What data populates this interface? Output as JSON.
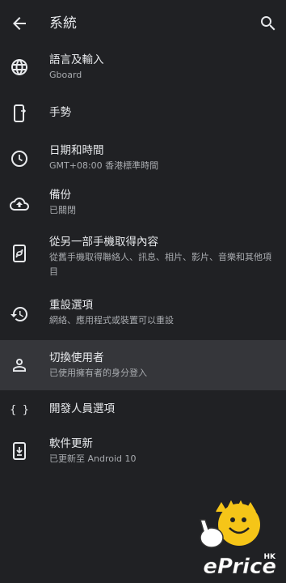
{
  "appbar": {
    "title": "系統",
    "back_icon": "arrow-back-icon",
    "search_icon": "search-icon"
  },
  "items": [
    {
      "label": "語言及輸入",
      "sub": "Gboard",
      "icon": "globe-icon"
    },
    {
      "label": "手勢",
      "sub": "",
      "icon": "phone-gesture-icon"
    },
    {
      "label": "日期和時間",
      "sub": "GMT+08:00 香港標準時間",
      "icon": "clock-icon"
    },
    {
      "label": "備份",
      "sub": "已關閉",
      "icon": "cloud-upload-icon"
    },
    {
      "label": "從另一部手機取得內容",
      "sub": "從舊手機取得聯絡人、訊息、相片、影片、音樂和其他項目",
      "icon": "phone-transfer-icon"
    },
    {
      "label": "重設選項",
      "sub": "網絡、應用程式或裝置可以重設",
      "icon": "history-icon"
    },
    {
      "label": "切換使用者",
      "sub": "已使用擁有者的身分登入",
      "icon": "person-icon"
    },
    {
      "label": "開發人員選項",
      "sub": "",
      "icon": "code-braces-icon"
    },
    {
      "label": "軟件更新",
      "sub": "已更新至 Android 10",
      "icon": "system-update-icon"
    }
  ],
  "watermark": {
    "text": "ePrice",
    "badge": "HK"
  },
  "colors": {
    "background": "#202124",
    "selected": "#35363a",
    "text": "#e8eaed",
    "subtext": "#a8abaf"
  }
}
